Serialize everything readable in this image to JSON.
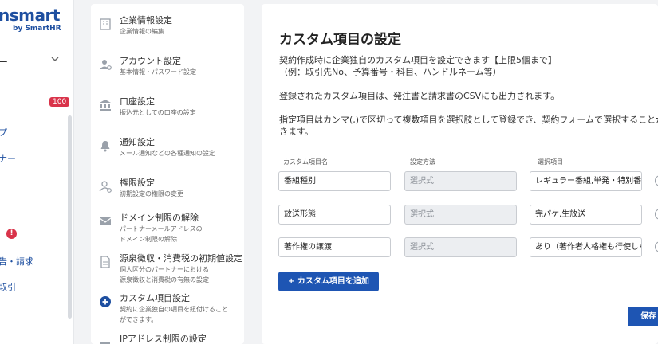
{
  "app": {
    "logo_text": "nsmart",
    "logo_by": "by SmartHR"
  },
  "leftnav": {
    "dash": "ー",
    "badge": "100",
    "alert": "!",
    "items": [
      "プ",
      "ナー",
      "告・請求",
      "取引"
    ]
  },
  "settings_menu": [
    {
      "title": "企業情報設定",
      "desc": [
        "企業情報の編集"
      ],
      "icon": "building-icon"
    },
    {
      "title": "アカウント設定",
      "desc": [
        "基本情報・パスワード設定"
      ],
      "icon": "user-gear-icon"
    },
    {
      "title": "口座設定",
      "desc": [
        "振込元としての口座の設定"
      ],
      "icon": "bank-icon"
    },
    {
      "title": "通知設定",
      "desc": [
        "メール通知などの各種通知の設定"
      ],
      "icon": "bell-icon"
    },
    {
      "title": "権限設定",
      "desc": [
        "初期設定の権限の変更"
      ],
      "icon": "user-key-icon"
    },
    {
      "title": "ドメイン制限の解除",
      "desc": [
        "パートナーメールアドレスの",
        "ドメイン制限の解除"
      ],
      "icon": "mail-icon"
    },
    {
      "title": "源泉徴収・消費税の初期値設定",
      "desc": [
        "個人区分のパートナーにおける",
        "源泉徴収と消費税の有無の設定"
      ],
      "icon": "document-icon"
    },
    {
      "title": "カスタム項目設定",
      "desc": [
        "契約に企業独自の項目を紐付けること",
        "ができます。"
      ],
      "icon": "plus-circle-icon"
    },
    {
      "title": "IPアドレス制限の設定",
      "desc": [],
      "icon": "lock-icon"
    }
  ],
  "panel": {
    "title": "カスタム項目の設定",
    "desc1": "契約作成時に企業独自のカスタム項目を設定できます【上限5個まで】",
    "desc2": "（例：取引先No、予算番号・科目、ハンドルネーム等）",
    "desc3": "登録されたカスタム項目は、発注書と請求書のCSVにも出力されます。",
    "desc4": "指定項目はカンマ(,)で区切って複数項目を選択肢として登録でき、契約フォームで選択することがで",
    "desc5": "きます。",
    "col_name": "カスタム項目名",
    "col_method": "設定方法",
    "col_options": "選択項目",
    "rows": [
      {
        "name": "番組種別",
        "method": "選択式",
        "options": "レギュラー番組,単発・特別番組"
      },
      {
        "name": "放送形態",
        "method": "選択式",
        "options": "完パケ,生放送"
      },
      {
        "name": "著作権の譲渡",
        "method": "選択式",
        "options": "あり（著作者人格権も行使しない）"
      }
    ],
    "add_button": "+ カスタム項目を追加",
    "save_button": "保存"
  }
}
